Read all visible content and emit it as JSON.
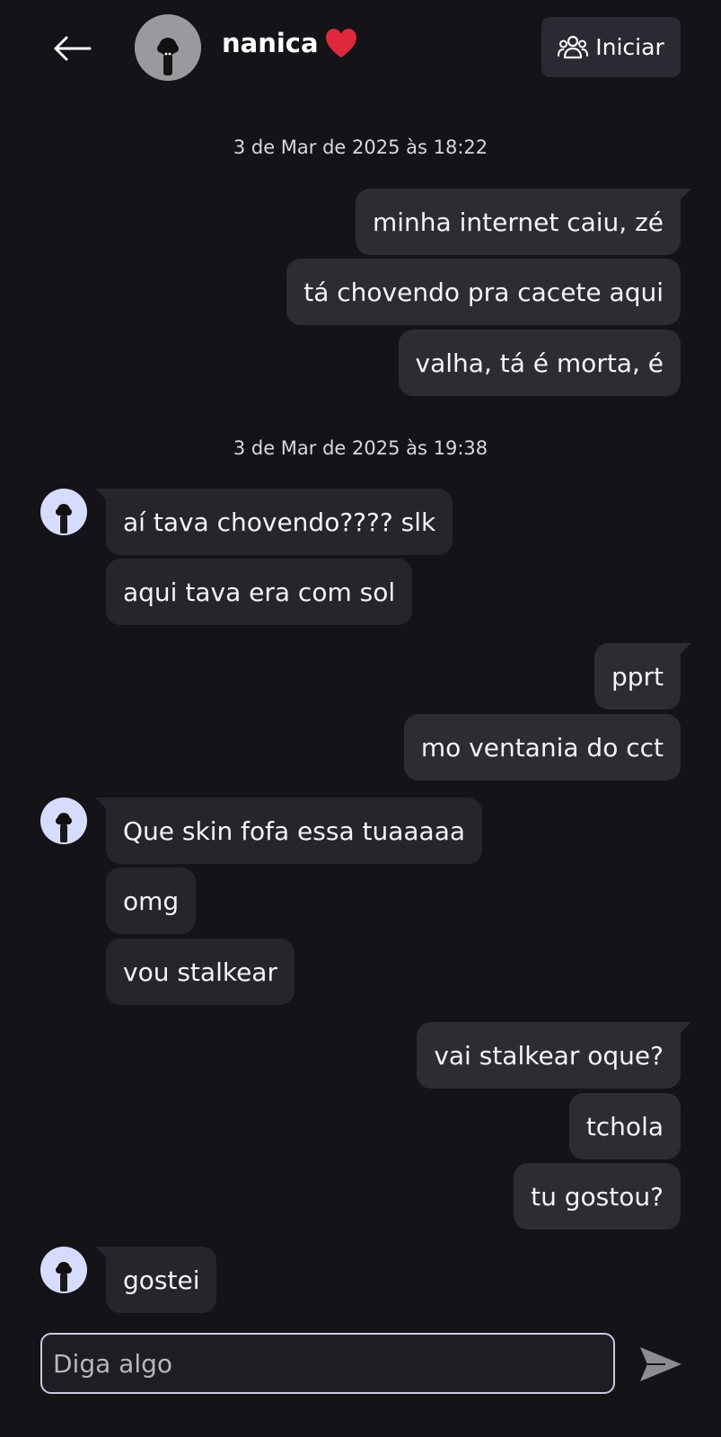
{
  "header": {
    "contact_name": "nanica",
    "heart_icon": "heart-icon",
    "heart_color": "#e0283c",
    "start_label": "Iniciar",
    "start_icon": "group-icon",
    "back_icon": "arrow-left-icon"
  },
  "chat": {
    "timestamps": [
      "3 de Mar de 2025 às 18:22",
      "3 de Mar de 2025 às 19:38"
    ],
    "messages": [
      {
        "dir": "out",
        "text": "minha internet caiu, zé"
      },
      {
        "dir": "out",
        "text": "tá chovendo pra cacete aqui"
      },
      {
        "dir": "out",
        "text": "valha, tá é morta, é"
      },
      {
        "dir": "in",
        "text": "aí tava chovendo???? slk"
      },
      {
        "dir": "in",
        "text": "aqui tava era com sol"
      },
      {
        "dir": "out",
        "text": "pprt"
      },
      {
        "dir": "out",
        "text": "mo ventania do cct"
      },
      {
        "dir": "in",
        "text": "Que skin fofa essa tuaaaaa"
      },
      {
        "dir": "in",
        "text": "omg"
      },
      {
        "dir": "in",
        "text": "vou stalkear"
      },
      {
        "dir": "out",
        "text": "vai stalkear oque?"
      },
      {
        "dir": "out",
        "text": "tchola"
      },
      {
        "dir": "out",
        "text": "tu gostou?"
      },
      {
        "dir": "in",
        "text": "gostei"
      }
    ]
  },
  "composer": {
    "placeholder": "Diga algo",
    "value": "",
    "send_icon": "send-icon"
  },
  "colors": {
    "background": "#131318",
    "bubble_out": "#2c2c33",
    "bubble_in": "#25252c",
    "input_border": "#c9cbe0",
    "avatar_bg": "#d6dcff"
  }
}
